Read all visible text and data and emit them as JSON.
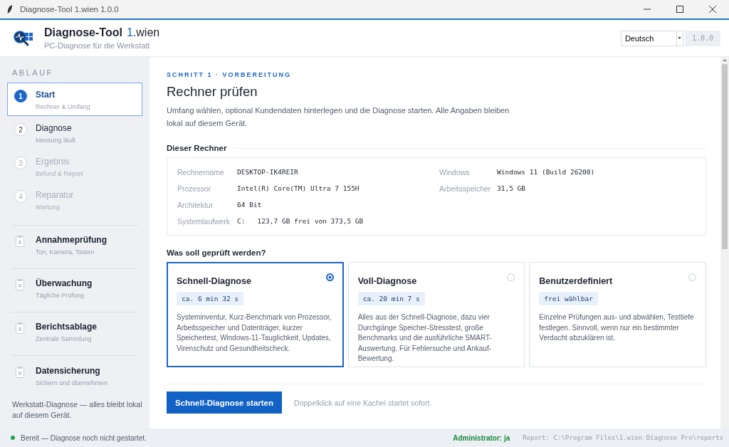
{
  "window": {
    "title": "Diagnose-Tool 1.wien 1.0.0"
  },
  "header": {
    "app_name": "Diagnose-Tool",
    "brand_number": "1",
    "brand_suffix": ".wien",
    "subtitle": "PC-Diagnose für die Werkstatt",
    "language": "Deutsch",
    "version": "1.0.0"
  },
  "sidebar": {
    "heading": "ABLAUF",
    "steps": [
      {
        "number": "1",
        "title": "Start",
        "subtitle": "Rechner & Umfang",
        "selected": true,
        "disabled": false
      },
      {
        "number": "2",
        "title": "Diagnose",
        "subtitle": "Messung läuft",
        "selected": false,
        "disabled": false
      },
      {
        "number": "3",
        "title": "Ergebnis",
        "subtitle": "Befund & Report",
        "selected": false,
        "disabled": true
      },
      {
        "number": "4",
        "title": "Reparatur",
        "subtitle": "Wartung",
        "selected": false,
        "disabled": true
      }
    ],
    "tools": [
      {
        "title": "Annahmeprüfung",
        "subtitle": "Ton, Kamera, Tasten"
      },
      {
        "title": "Überwachung",
        "subtitle": "Tägliche Prüfung"
      },
      {
        "title": "Berichtsablage",
        "subtitle": "Zentrale Sammlung"
      },
      {
        "title": "Datensicherung",
        "subtitle": "Sichern und übernehmen"
      }
    ],
    "footer": "Werkstatt-Diagnose — alles bleibt lokal auf diesem Gerät."
  },
  "main": {
    "eyebrow": "SCHRITT 1 · VORBEREITUNG",
    "title": "Rechner prüfen",
    "intro": "Umfang wählen, optional Kundendaten hinterlegen und die Diagnose starten. Alle Angaben bleiben lokal auf diesem Gerät.",
    "computer": {
      "heading": "Dieser Rechner",
      "left_fields": [
        {
          "label": "Rechnername",
          "value": "DESKTOP-IK4REIR"
        },
        {
          "label": "Prozessor",
          "value": "Intel(R) Core(TM) Ultra 7 155H"
        },
        {
          "label": "Architektur",
          "value": "64 Bit"
        },
        {
          "label": "Systemlaufwerk",
          "value": "C:   123,7 GB frei von 373,5 GB"
        }
      ],
      "right_fields": [
        {
          "label": "Windows",
          "value": "Windows 11 (Build 26200)"
        },
        {
          "label": "Arbeitsspeicher",
          "value": "31,5 GB"
        }
      ]
    },
    "scope": {
      "heading": "Was soll geprüft werden?",
      "options": [
        {
          "title": "Schnell-Diagnose",
          "duration": "ca. 6 min 32 s",
          "description": "Systeminventur, Kurz-Benchmark von Prozessor, Arbeitsspeicher und Datenträger, kurzer Speichertest, Windows-11-Tauglichkeit, Updates, Virenschutz und Gesundheitscheck.",
          "selected": true
        },
        {
          "title": "Voll-Diagnose",
          "duration": "ca. 20 min 7 s",
          "description": "Alles aus der Schnell-Diagnose, dazu vier Durchgänge Speicher-Stresstest, große Benchmarks und die ausführliche SMART-Auswertung. Für Fehlersuche und Ankauf-Bewertung.",
          "selected": false
        },
        {
          "title": "Benutzerdefiniert",
          "duration": "frei wählbar",
          "description": "Einzelne Prüfungen aus- und abwählen, Testtiefe festlegen. Sinnvoll, wenn nur ein bestimmter Verdacht abzuklären ist.",
          "selected": false
        }
      ]
    },
    "start_button": "Schnell-Diagnose starten",
    "hint": "Doppelklick auf eine Kachel startet sofort."
  },
  "status_bar": {
    "status": "Bereit — Diagnose noch nicht gestartet.",
    "admin": "Administrator: ja",
    "report": "Report: C:\\Program Files\\1.wien Diagnose Pro\\reports"
  }
}
